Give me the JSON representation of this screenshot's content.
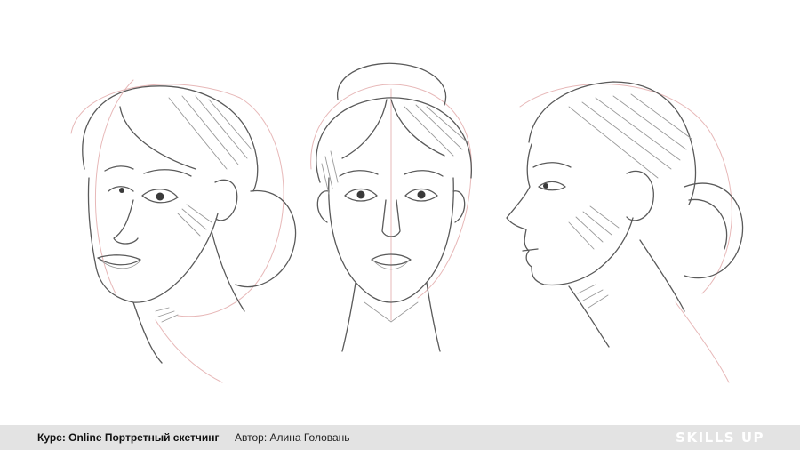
{
  "footer": {
    "course": "Курс: Online Портретный скетчинг",
    "author": "Автор: Алина Головань",
    "logo": "SKILLS UP"
  }
}
